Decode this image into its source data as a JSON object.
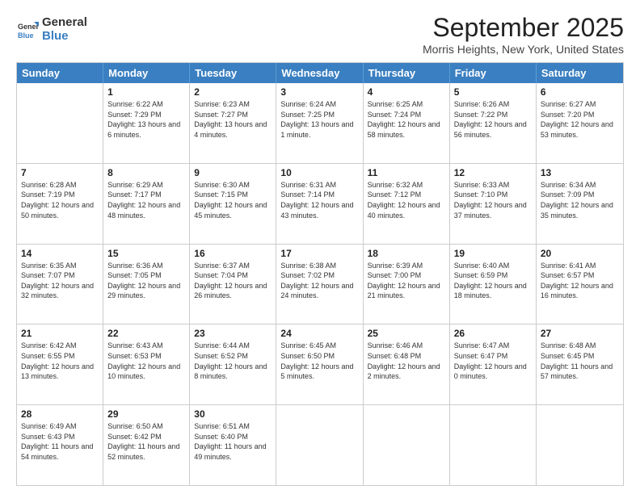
{
  "logo": {
    "general": "General",
    "blue": "Blue"
  },
  "title": "September 2025",
  "location": "Morris Heights, New York, United States",
  "days": [
    "Sunday",
    "Monday",
    "Tuesday",
    "Wednesday",
    "Thursday",
    "Friday",
    "Saturday"
  ],
  "weeks": [
    [
      {
        "day": null
      },
      {
        "day": "1",
        "sunrise": "6:22 AM",
        "sunset": "7:29 PM",
        "daylight": "13 hours and 6 minutes."
      },
      {
        "day": "2",
        "sunrise": "6:23 AM",
        "sunset": "7:27 PM",
        "daylight": "13 hours and 4 minutes."
      },
      {
        "day": "3",
        "sunrise": "6:24 AM",
        "sunset": "7:25 PM",
        "daylight": "13 hours and 1 minute."
      },
      {
        "day": "4",
        "sunrise": "6:25 AM",
        "sunset": "7:24 PM",
        "daylight": "12 hours and 58 minutes."
      },
      {
        "day": "5",
        "sunrise": "6:26 AM",
        "sunset": "7:22 PM",
        "daylight": "12 hours and 56 minutes."
      },
      {
        "day": "6",
        "sunrise": "6:27 AM",
        "sunset": "7:20 PM",
        "daylight": "12 hours and 53 minutes."
      }
    ],
    [
      {
        "day": "7",
        "sunrise": "6:28 AM",
        "sunset": "7:19 PM",
        "daylight": "12 hours and 50 minutes."
      },
      {
        "day": "8",
        "sunrise": "6:29 AM",
        "sunset": "7:17 PM",
        "daylight": "12 hours and 48 minutes."
      },
      {
        "day": "9",
        "sunrise": "6:30 AM",
        "sunset": "7:15 PM",
        "daylight": "12 hours and 45 minutes."
      },
      {
        "day": "10",
        "sunrise": "6:31 AM",
        "sunset": "7:14 PM",
        "daylight": "12 hours and 43 minutes."
      },
      {
        "day": "11",
        "sunrise": "6:32 AM",
        "sunset": "7:12 PM",
        "daylight": "12 hours and 40 minutes."
      },
      {
        "day": "12",
        "sunrise": "6:33 AM",
        "sunset": "7:10 PM",
        "daylight": "12 hours and 37 minutes."
      },
      {
        "day": "13",
        "sunrise": "6:34 AM",
        "sunset": "7:09 PM",
        "daylight": "12 hours and 35 minutes."
      }
    ],
    [
      {
        "day": "14",
        "sunrise": "6:35 AM",
        "sunset": "7:07 PM",
        "daylight": "12 hours and 32 minutes."
      },
      {
        "day": "15",
        "sunrise": "6:36 AM",
        "sunset": "7:05 PM",
        "daylight": "12 hours and 29 minutes."
      },
      {
        "day": "16",
        "sunrise": "6:37 AM",
        "sunset": "7:04 PM",
        "daylight": "12 hours and 26 minutes."
      },
      {
        "day": "17",
        "sunrise": "6:38 AM",
        "sunset": "7:02 PM",
        "daylight": "12 hours and 24 minutes."
      },
      {
        "day": "18",
        "sunrise": "6:39 AM",
        "sunset": "7:00 PM",
        "daylight": "12 hours and 21 minutes."
      },
      {
        "day": "19",
        "sunrise": "6:40 AM",
        "sunset": "6:59 PM",
        "daylight": "12 hours and 18 minutes."
      },
      {
        "day": "20",
        "sunrise": "6:41 AM",
        "sunset": "6:57 PM",
        "daylight": "12 hours and 16 minutes."
      }
    ],
    [
      {
        "day": "21",
        "sunrise": "6:42 AM",
        "sunset": "6:55 PM",
        "daylight": "12 hours and 13 minutes."
      },
      {
        "day": "22",
        "sunrise": "6:43 AM",
        "sunset": "6:53 PM",
        "daylight": "12 hours and 10 minutes."
      },
      {
        "day": "23",
        "sunrise": "6:44 AM",
        "sunset": "6:52 PM",
        "daylight": "12 hours and 8 minutes."
      },
      {
        "day": "24",
        "sunrise": "6:45 AM",
        "sunset": "6:50 PM",
        "daylight": "12 hours and 5 minutes."
      },
      {
        "day": "25",
        "sunrise": "6:46 AM",
        "sunset": "6:48 PM",
        "daylight": "12 hours and 2 minutes."
      },
      {
        "day": "26",
        "sunrise": "6:47 AM",
        "sunset": "6:47 PM",
        "daylight": "12 hours and 0 minutes."
      },
      {
        "day": "27",
        "sunrise": "6:48 AM",
        "sunset": "6:45 PM",
        "daylight": "11 hours and 57 minutes."
      }
    ],
    [
      {
        "day": "28",
        "sunrise": "6:49 AM",
        "sunset": "6:43 PM",
        "daylight": "11 hours and 54 minutes."
      },
      {
        "day": "29",
        "sunrise": "6:50 AM",
        "sunset": "6:42 PM",
        "daylight": "11 hours and 52 minutes."
      },
      {
        "day": "30",
        "sunrise": "6:51 AM",
        "sunset": "6:40 PM",
        "daylight": "11 hours and 49 minutes."
      },
      {
        "day": null
      },
      {
        "day": null
      },
      {
        "day": null
      },
      {
        "day": null
      }
    ]
  ]
}
